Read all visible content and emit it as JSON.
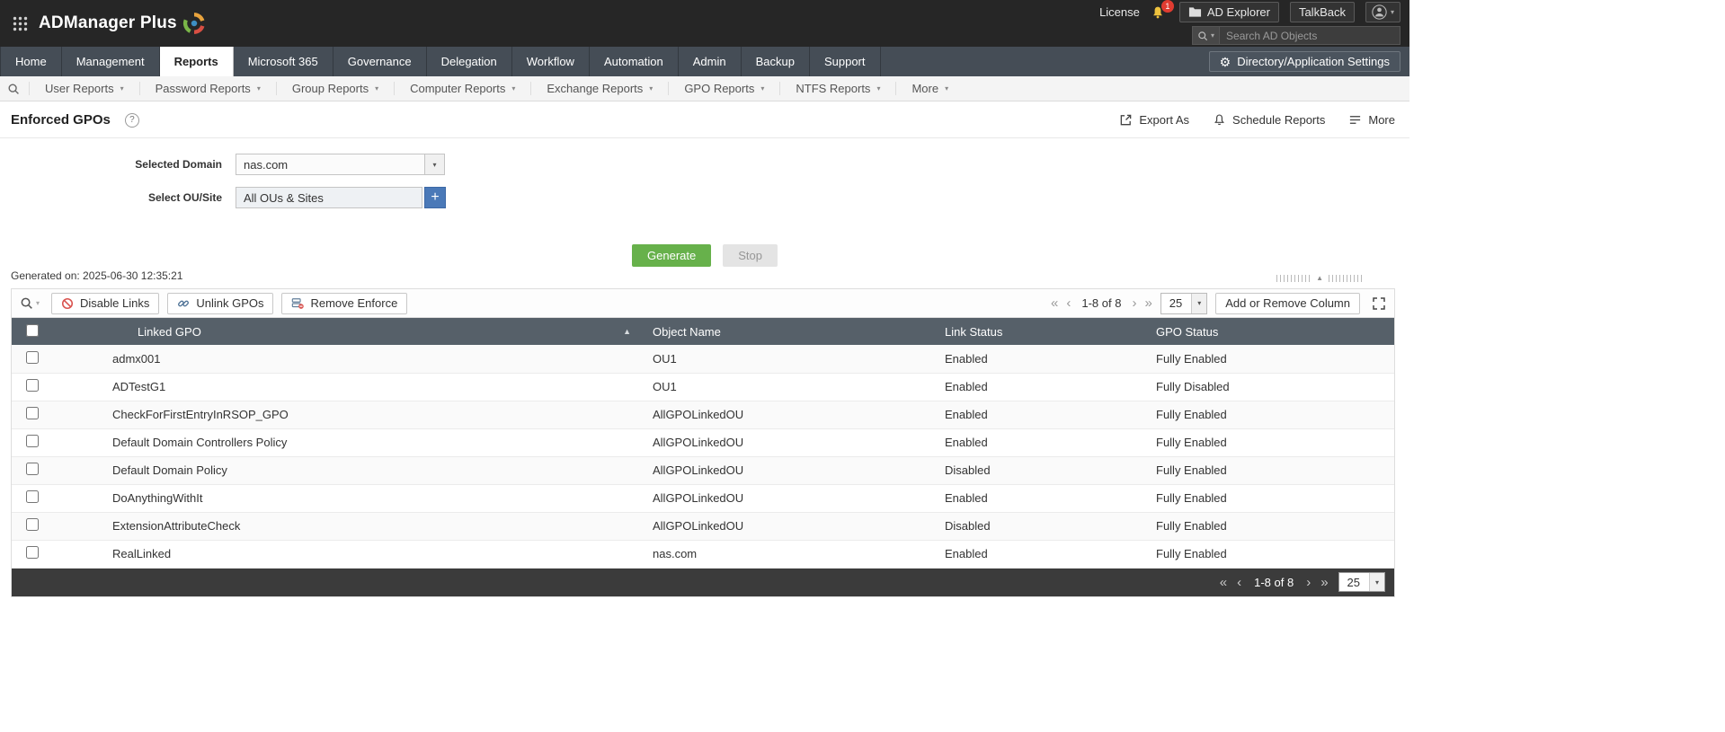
{
  "icons": {
    "gear": "⚙",
    "caret_down": "▾",
    "sort_asc": "▲",
    "first": "«",
    "prev": "‹",
    "next": "›",
    "last": "»",
    "plus": "+",
    "help": "?",
    "handle_up": "▲"
  },
  "colors": {
    "topbar_bg": "#262626",
    "navbar_bg": "#454d56",
    "accent_green": "#67b14b",
    "add_button_blue": "#4a79b8",
    "table_header_bg": "#566069",
    "badge_red": "#e03c31"
  },
  "topbar": {
    "brand": "ADManager Plus",
    "license_label": "License",
    "notification_count": "1",
    "ad_explorer_label": "AD Explorer",
    "talkback_label": "TalkBack",
    "search_placeholder": "Search AD Objects"
  },
  "nav": {
    "tabs": [
      {
        "label": "Home",
        "active": false
      },
      {
        "label": "Management",
        "active": false
      },
      {
        "label": "Reports",
        "active": true
      },
      {
        "label": "Microsoft 365",
        "active": false
      },
      {
        "label": "Governance",
        "active": false
      },
      {
        "label": "Delegation",
        "active": false
      },
      {
        "label": "Workflow",
        "active": false
      },
      {
        "label": "Automation",
        "active": false
      },
      {
        "label": "Admin",
        "active": false
      },
      {
        "label": "Backup",
        "active": false
      },
      {
        "label": "Support",
        "active": false
      }
    ],
    "settings_label": "Directory/Application Settings"
  },
  "subnav": {
    "items": [
      "User Reports",
      "Password Reports",
      "Group Reports",
      "Computer Reports",
      "Exchange Reports",
      "GPO Reports",
      "NTFS Reports",
      "More"
    ]
  },
  "page": {
    "title": "Enforced GPOs",
    "export_label": "Export As",
    "schedule_label": "Schedule Reports",
    "more_label": "More"
  },
  "form": {
    "domain_label": "Selected Domain",
    "domain_value": "nas.com",
    "ou_label": "Select OU/Site",
    "ou_value": "All OUs & Sites",
    "generate_label": "Generate",
    "stop_label": "Stop",
    "generated_on": "Generated on: 2025-06-30 12:35:21"
  },
  "toolbar": {
    "disable_links": "Disable Links",
    "unlink_gpos": "Unlink GPOs",
    "remove_enforce": "Remove Enforce",
    "page_info": "1-8 of 8",
    "page_size": "25",
    "add_remove_column": "Add or Remove Column"
  },
  "table": {
    "columns": [
      "Linked GPO",
      "Object Name",
      "Link Status",
      "GPO Status"
    ],
    "rows": [
      {
        "linked_gpo": "admx001",
        "object_name": "OU1",
        "link_status": "Enabled",
        "gpo_status": "Fully Enabled"
      },
      {
        "linked_gpo": "ADTestG1",
        "object_name": "OU1",
        "link_status": "Enabled",
        "gpo_status": "Fully Disabled"
      },
      {
        "linked_gpo": "CheckForFirstEntryInRSOP_GPO",
        "object_name": "AllGPOLinkedOU",
        "link_status": "Enabled",
        "gpo_status": "Fully Enabled"
      },
      {
        "linked_gpo": "Default Domain Controllers Policy",
        "object_name": "AllGPOLinkedOU",
        "link_status": "Enabled",
        "gpo_status": "Fully Enabled"
      },
      {
        "linked_gpo": "Default Domain Policy",
        "object_name": "AllGPOLinkedOU",
        "link_status": "Disabled",
        "gpo_status": "Fully Enabled"
      },
      {
        "linked_gpo": "DoAnythingWithIt",
        "object_name": "AllGPOLinkedOU",
        "link_status": "Enabled",
        "gpo_status": "Fully Enabled"
      },
      {
        "linked_gpo": "ExtensionAttributeCheck",
        "object_name": "AllGPOLinkedOU",
        "link_status": "Disabled",
        "gpo_status": "Fully Enabled"
      },
      {
        "linked_gpo": "RealLinked",
        "object_name": "nas.com",
        "link_status": "Enabled",
        "gpo_status": "Fully Enabled"
      }
    ]
  },
  "footer": {
    "page_info": "1-8 of 8",
    "page_size": "25"
  }
}
